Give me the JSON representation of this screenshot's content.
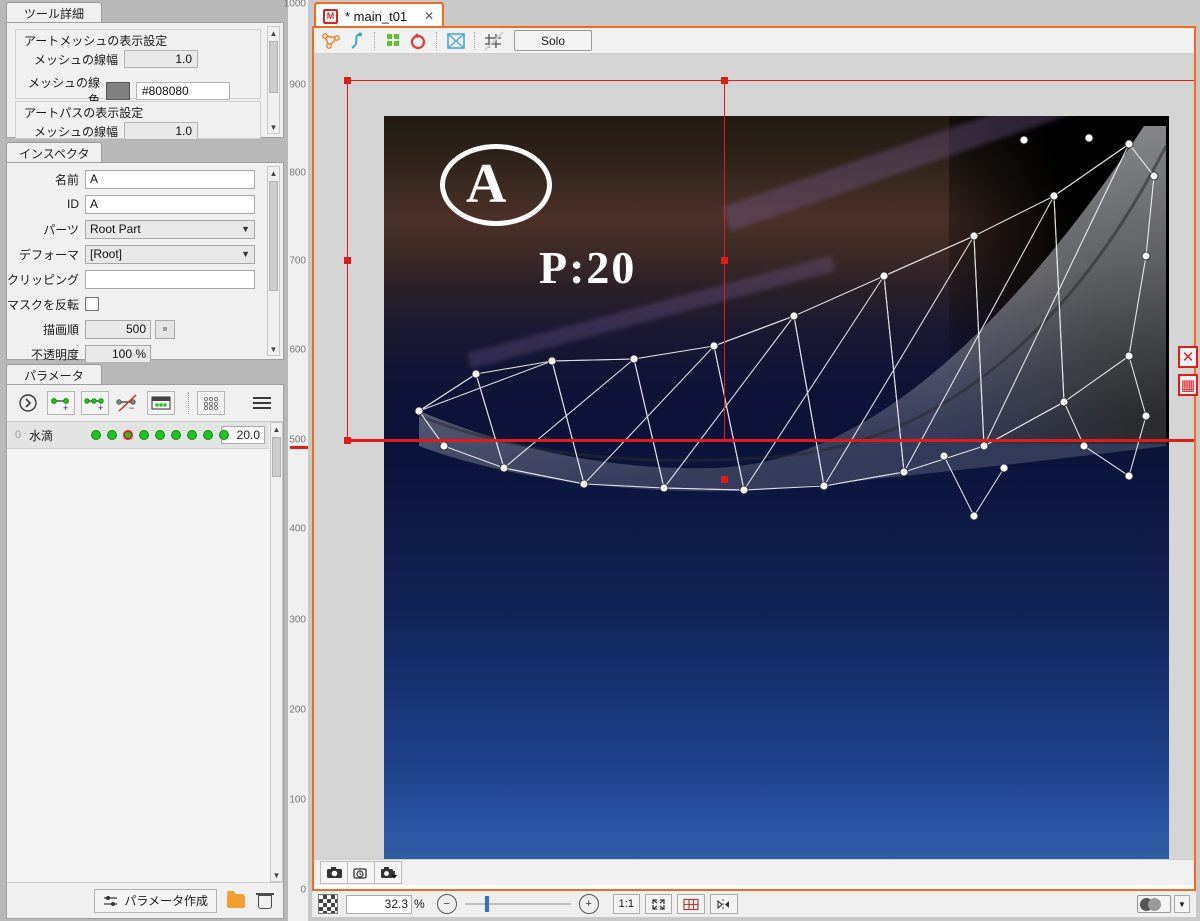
{
  "tool_detail": {
    "tab_label": "ツール詳細",
    "sections": [
      {
        "title": "アートメッシュの表示設定",
        "rows": [
          {
            "label": "メッシュの線幅",
            "value": "1.0",
            "type": "number"
          },
          {
            "label": "メッシュの線色",
            "value": "#808080",
            "type": "color",
            "swatch": "#808080"
          }
        ]
      },
      {
        "title": "アートパスの表示設定",
        "rows": [
          {
            "label": "メッシュの線幅",
            "value": "1.0",
            "type": "number"
          }
        ]
      }
    ]
  },
  "inspector": {
    "tab_label": "インスペクタ",
    "rows": [
      {
        "label": "名前",
        "value": "A",
        "type": "text"
      },
      {
        "label": "ID",
        "value": "A",
        "type": "text"
      },
      {
        "label": "パーツ",
        "value": "Root Part",
        "type": "combo"
      },
      {
        "label": "デフォーマ",
        "value": "[Root]",
        "type": "combo"
      },
      {
        "label": "クリッピング",
        "value": "",
        "type": "text"
      },
      {
        "label": "マスクを反転",
        "value": "",
        "type": "checkbox",
        "checked": false
      },
      {
        "label": "描画順",
        "value": "500",
        "type": "number_button"
      },
      {
        "label": "不透明度",
        "value": "100 %",
        "type": "number"
      }
    ]
  },
  "parameters": {
    "tab_label": "パラメータ",
    "toolbar_icons": [
      "play-circle-icon",
      "add-keyform-icon",
      "add-keyform-multi-icon",
      "delete-keyform-icon",
      "keyform-edit-icon",
      "parameter-grid-icon",
      "menu-icon"
    ],
    "rows": [
      {
        "index": "0",
        "name": "水滴",
        "value": "20.0",
        "keypoint_count": 9,
        "selected_keypoint": 2
      }
    ],
    "footer": {
      "create_label": "パラメータ作成",
      "create_icon": "create-parameter-icon",
      "folder_icon": "folder-icon",
      "delete_icon": "trash-icon"
    }
  },
  "ruler": {
    "ticks": [
      "1000",
      "900",
      "800",
      "700",
      "600",
      "500",
      "400",
      "300",
      "200",
      "100",
      "0"
    ],
    "marker_value": "500",
    "marker_color": "#e01b1b"
  },
  "viewport": {
    "tab": {
      "label": "* main_t01",
      "icon": "model-file-icon",
      "close_icon": "close-icon",
      "modified": true
    },
    "toolbar": {
      "icons": [
        "mesh-vertex-icon",
        "art-path-icon",
        "mesh-edit-icon",
        "mesh-undo-icon",
        "mesh-box-icon",
        "grid-disabled-icon"
      ],
      "solo_label": "Solo"
    },
    "snapshot_bar": {
      "icons": [
        "camera-icon",
        "camera-history-icon",
        "camera-export-icon"
      ]
    },
    "status_bar": {
      "background_icon": "checker-background-icon",
      "zoom_value": "32.3",
      "zoom_unit": "%",
      "zoom_out_icon": "zoom-out-icon",
      "zoom_in_icon": "zoom-in-icon",
      "slider_position_pct": 20,
      "buttons": [
        {
          "label": "1:1",
          "name": "actual-size-button"
        },
        {
          "label": "",
          "name": "fit-to-screen-button"
        },
        {
          "label": "",
          "name": "grid-toggle-button"
        },
        {
          "label": "",
          "name": "mirror-edit-button"
        }
      ],
      "toggle_icon": "onion-skin-toggle",
      "caret_icon": "chevron-down-icon"
    },
    "right_edge_icons": [
      {
        "name": "close-mesh-editor-icon",
        "glyph": "✕",
        "color": "#e01b1b"
      },
      {
        "name": "mesh-grid-icon",
        "glyph": "▦",
        "color": "#e01b1b"
      }
    ],
    "canvas": {
      "annotations": [
        {
          "name": "circled-letter-a",
          "text": "A",
          "type": "circled"
        },
        {
          "name": "parameter-note",
          "text": "P:20",
          "type": "text"
        }
      ],
      "selection_color": "#e01b1b",
      "mesh_line_color": "#ffffff"
    }
  }
}
